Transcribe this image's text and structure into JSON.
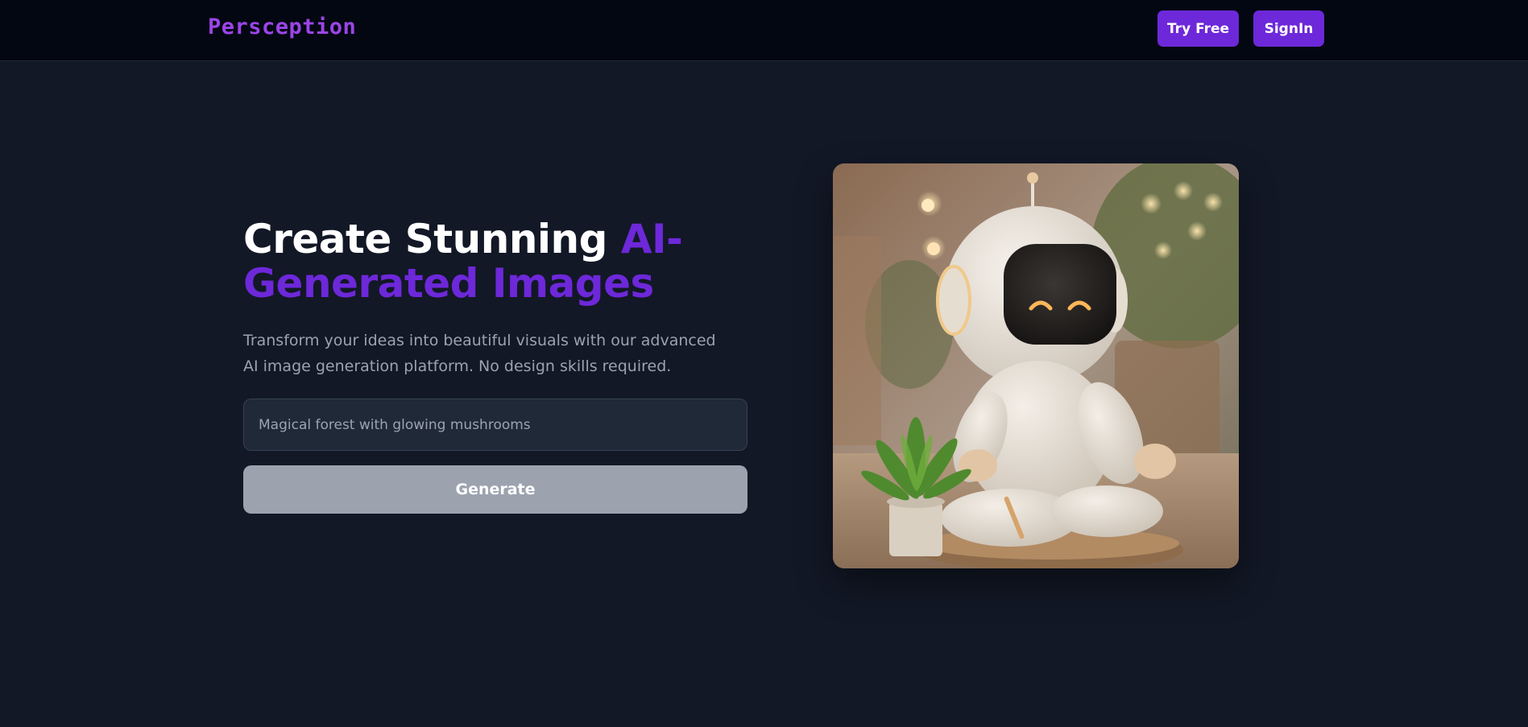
{
  "header": {
    "logo": "Persception",
    "try_free_label": "Try Free",
    "signin_label": "SignIn"
  },
  "hero": {
    "title_part1": "Create Stunning ",
    "title_accent": "AI-Generated Images",
    "subtitle": "Transform your ideas into beautiful visuals with our advanced AI image generation platform. No design skills required.",
    "prompt_placeholder": "Magical forest with glowing mushrooms",
    "generate_label": "Generate"
  },
  "colors": {
    "background": "#121826",
    "topbar": "#030712",
    "accent": "#6d28d9",
    "logo": "#9b45e8",
    "muted_text": "#9ca3af",
    "input_bg": "#1f2937"
  }
}
